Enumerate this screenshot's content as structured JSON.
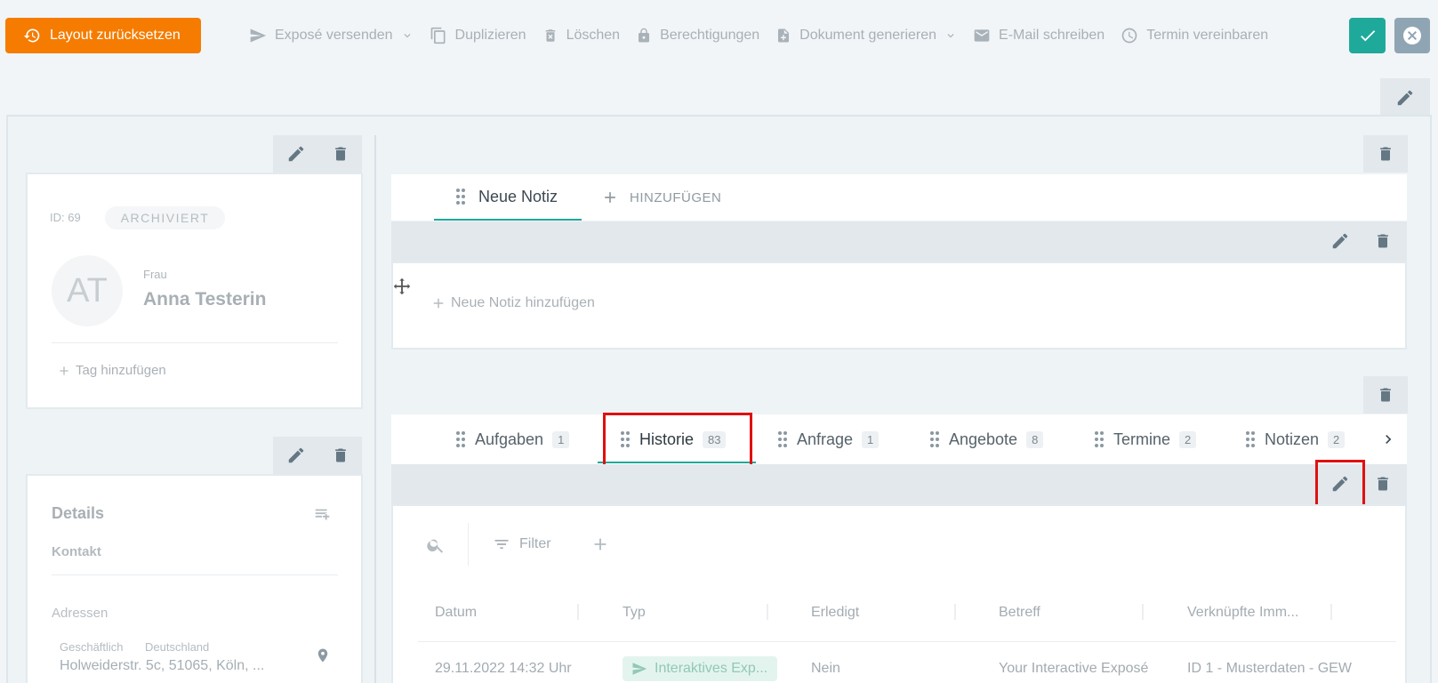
{
  "toolbar": {
    "reset_label": "Layout zurücksetzen",
    "items": [
      {
        "label": "Exposé versenden",
        "icon": "send-icon",
        "dropdown": true
      },
      {
        "label": "Duplizieren",
        "icon": "copy-icon"
      },
      {
        "label": "Löschen",
        "icon": "trash-icon"
      },
      {
        "label": "Berechtigungen",
        "icon": "lock-icon"
      },
      {
        "label": "Dokument generieren",
        "icon": "file-add-icon",
        "dropdown": true
      },
      {
        "label": "E-Mail schreiben",
        "icon": "mail-icon"
      },
      {
        "label": "Termin vereinbaren",
        "icon": "clock-icon"
      }
    ]
  },
  "profile": {
    "id_text": "ID: 69",
    "status_badge": "ARCHIVIERT",
    "avatar_initials": "AT",
    "salutation": "Frau",
    "name": "Anna Testerin",
    "add_tag": "Tag hinzufügen"
  },
  "details": {
    "title": "Details",
    "section": "Kontakt",
    "addresses_label": "Adressen",
    "address_type": "Geschäftlich",
    "address_country": "Deutschland",
    "address_text": "Holweiderstr. 5c, 51065, Köln, ..."
  },
  "notes_widget": {
    "tab_label": "Neue Notiz",
    "add_tab_label": "HINZUFÜGEN",
    "add_note": "Neue Notiz hinzufügen"
  },
  "history_widget": {
    "tabs": [
      {
        "label": "Aufgaben",
        "count": "1"
      },
      {
        "label": "Historie",
        "count": "83"
      },
      {
        "label": "Anfrage",
        "count": "1"
      },
      {
        "label": "Angebote",
        "count": "8"
      },
      {
        "label": "Termine",
        "count": "2"
      },
      {
        "label": "Notizen",
        "count": "2"
      }
    ],
    "filter_label": "Filter",
    "columns": [
      "Datum",
      "Typ",
      "Erledigt",
      "Betreff",
      "Verknüpfte Imm..."
    ],
    "rows": [
      {
        "datum": "29.11.2022 14:32 Uhr",
        "typ": "Interaktives Exp...",
        "erledigt": "Nein",
        "betreff": "Your Interactive Exposé",
        "immobilie": "ID 1 - Musterdaten - GEW"
      }
    ]
  },
  "colors": {
    "accent": "#1fa99b",
    "warning": "#f57c00",
    "highlight": "#e01010"
  }
}
